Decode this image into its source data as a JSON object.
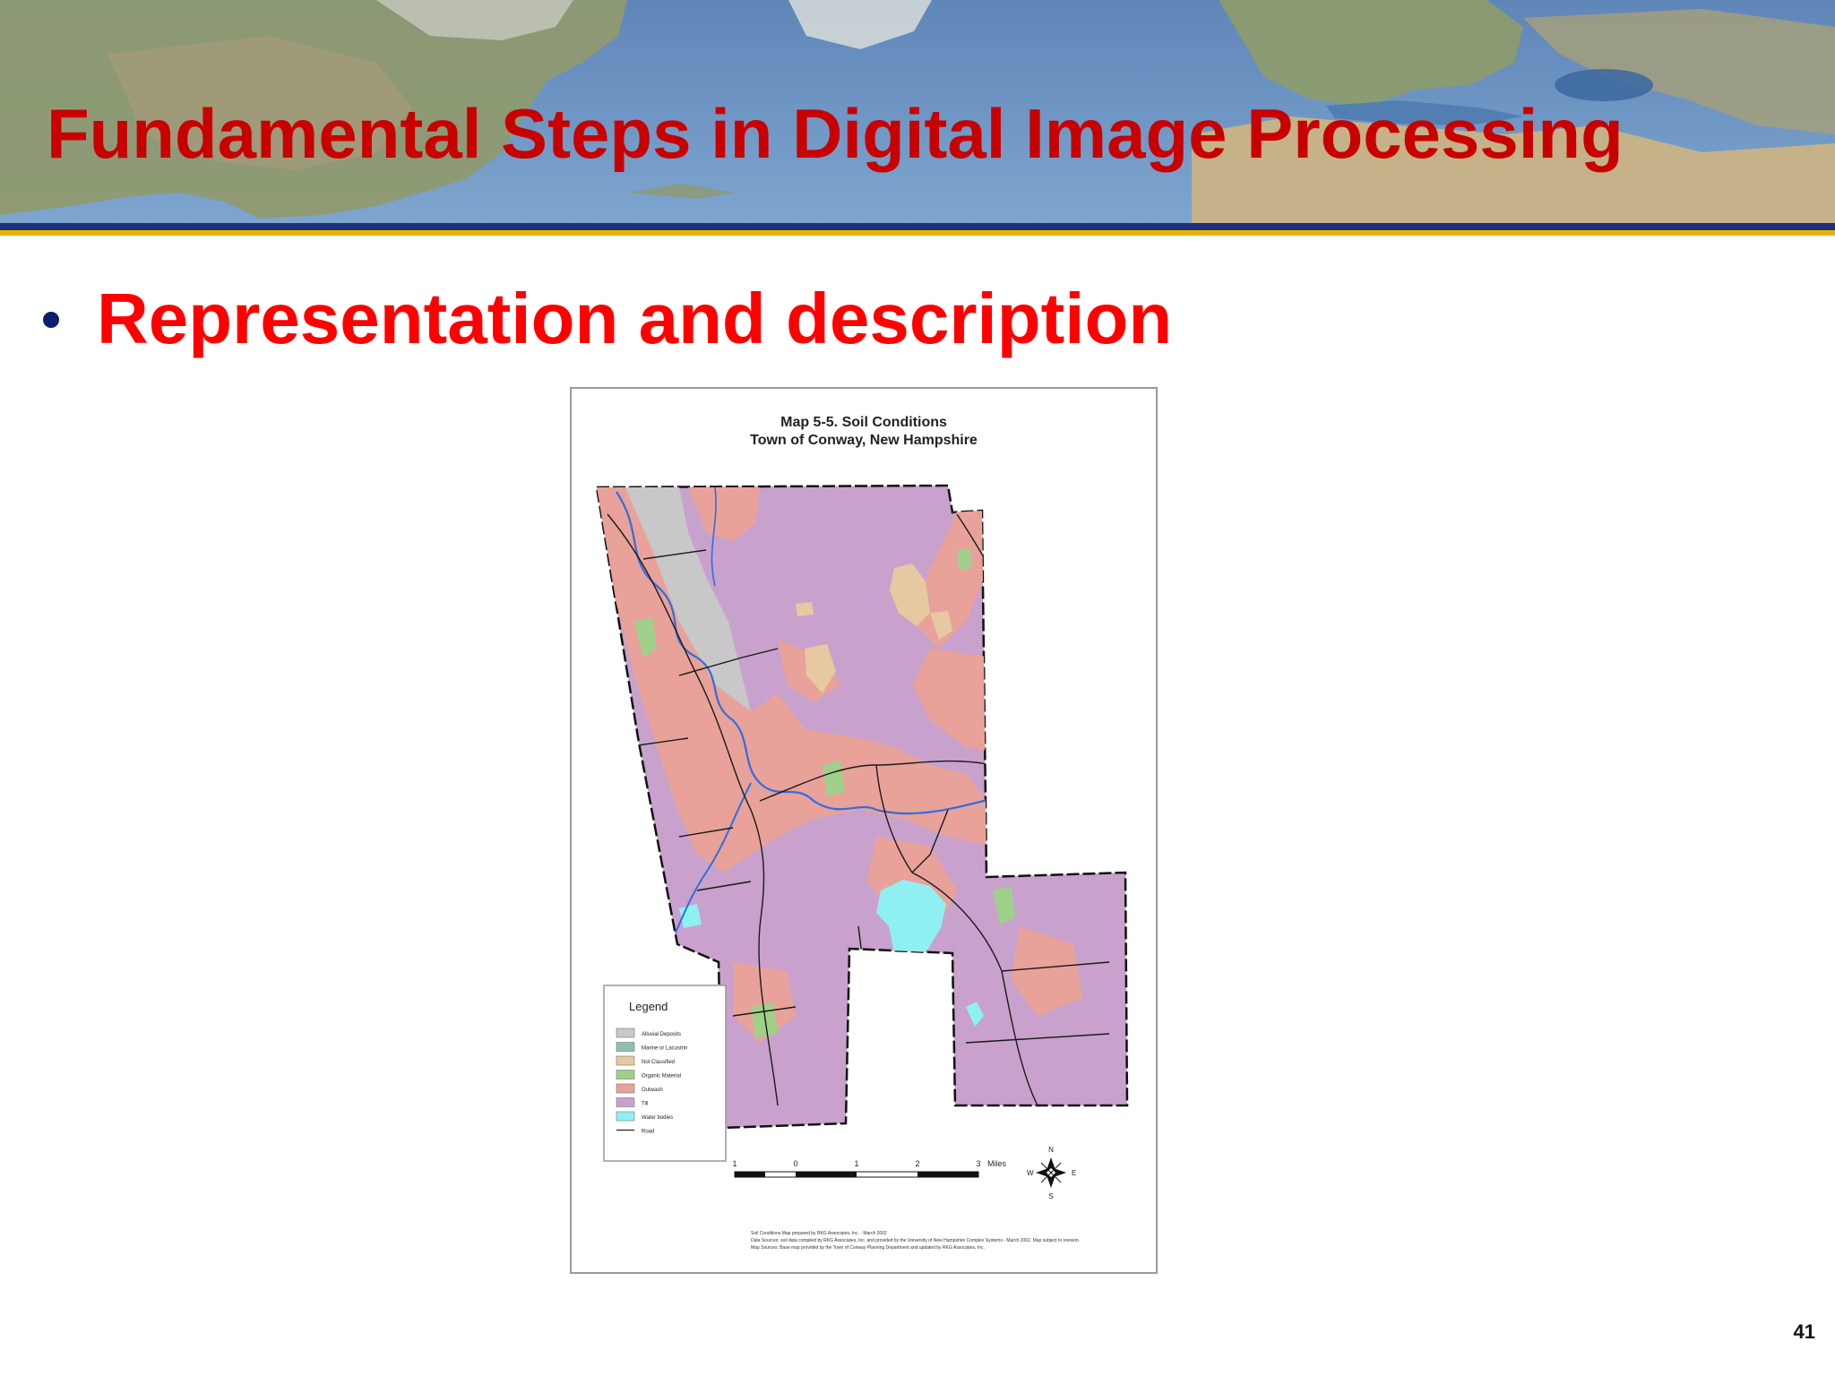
{
  "slide": {
    "title": "Fundamental Steps in Digital Image Processing",
    "bullet": "Representation and description",
    "page_number": "41"
  },
  "map": {
    "title_line1": "Map 5-5.  Soil Conditions",
    "title_line2": "Town of Conway, New Hampshire",
    "legend": {
      "heading": "Legend",
      "items": [
        {
          "label": "Alluvial Deposits",
          "color": "#c8c8c8"
        },
        {
          "label": "Marine or Lacustrin",
          "color": "#8fbfb0"
        },
        {
          "label": "Not Classified",
          "color": "#e6c9a0"
        },
        {
          "label": "Organic Material",
          "color": "#9fd08a"
        },
        {
          "label": "Outwash",
          "color": "#e8a29a"
        },
        {
          "label": "Till",
          "color": "#c8a2cc"
        },
        {
          "label": "Water bodies",
          "color": "#8ff0f2"
        },
        {
          "label": "Road",
          "color": "#222222"
        }
      ]
    },
    "scale": {
      "labels": [
        "1",
        "0",
        "1",
        "2",
        "3"
      ],
      "unit": "Miles"
    },
    "compass": {
      "n": "N",
      "s": "S",
      "e": "E",
      "w": "W"
    },
    "credits": [
      "Soil Conditions Map prepared by RKG Associates, Inc. - March 2002",
      "Data Sources: soil data compiled by RKG Associates, Inc. and provided by the University of New Hampshire Complex Systems - March 2002.  Map subject to revision.",
      "Map Sources: Base map provided by the Town of Conway Planning Department and updated by RKG Associates, Inc."
    ]
  },
  "colors": {
    "title": "#c80000",
    "bullet_text": "#ff0000",
    "bullet_dot": "#0b1f6e",
    "stripe_navy": "#1f2f7a",
    "stripe_gold": "#e8b400",
    "till": "#c8a2cc",
    "outwash": "#e8a29a",
    "alluvial": "#c8c8c8",
    "organic": "#9fd08a",
    "not_classified": "#e6c9a0",
    "water": "#8ff0f2"
  }
}
